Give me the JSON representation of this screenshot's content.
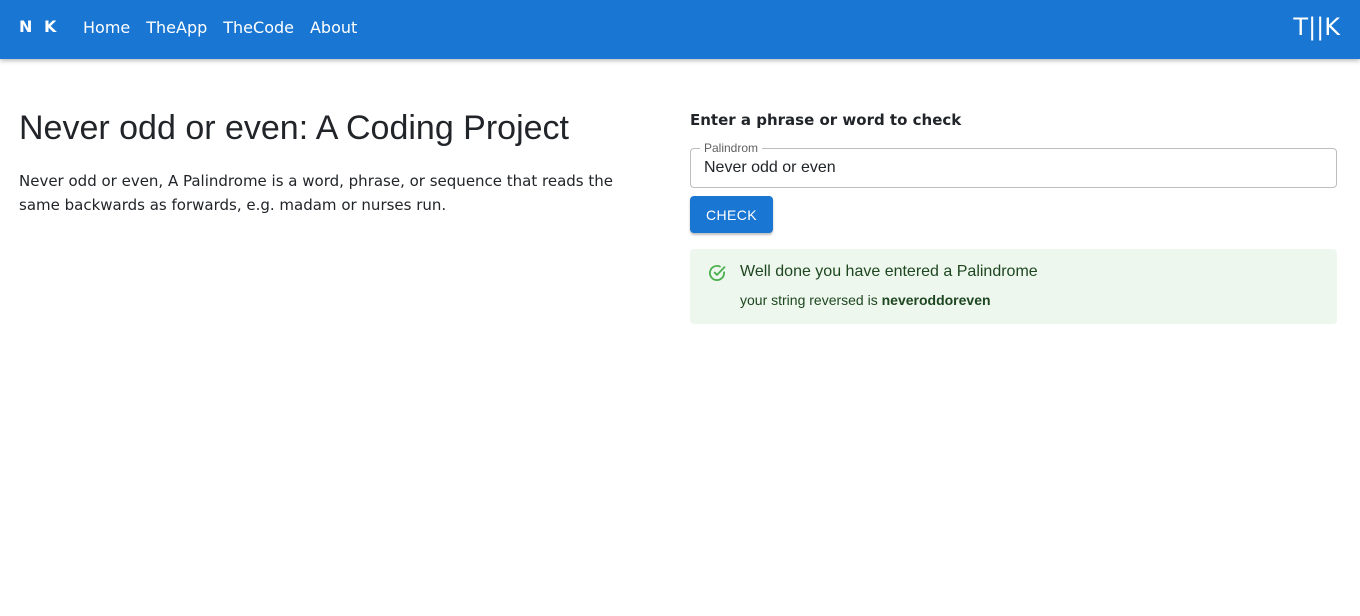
{
  "navbar": {
    "brand": "N K",
    "links": [
      "Home",
      "TheApp",
      "TheCode",
      "About"
    ],
    "right_logo": "T||K",
    "color": "#1976d2"
  },
  "main": {
    "title": "Never odd or even: A Coding Project",
    "description": "Never odd or even, A Palindrome is a word, phrase, or sequence that reads the same backwards as forwards, e.g. madam or nurses run."
  },
  "form": {
    "label": "Enter a phrase or word to check",
    "field_legend": "Palindrom",
    "field_value": "Never odd or even",
    "button_label": "CHECK"
  },
  "result": {
    "icon": "check-circle-icon",
    "title": "Well done you have entered a Palindrome",
    "body_prefix": "your string reversed is ",
    "reversed": "neveroddoreven",
    "background": "#edf7ed"
  }
}
